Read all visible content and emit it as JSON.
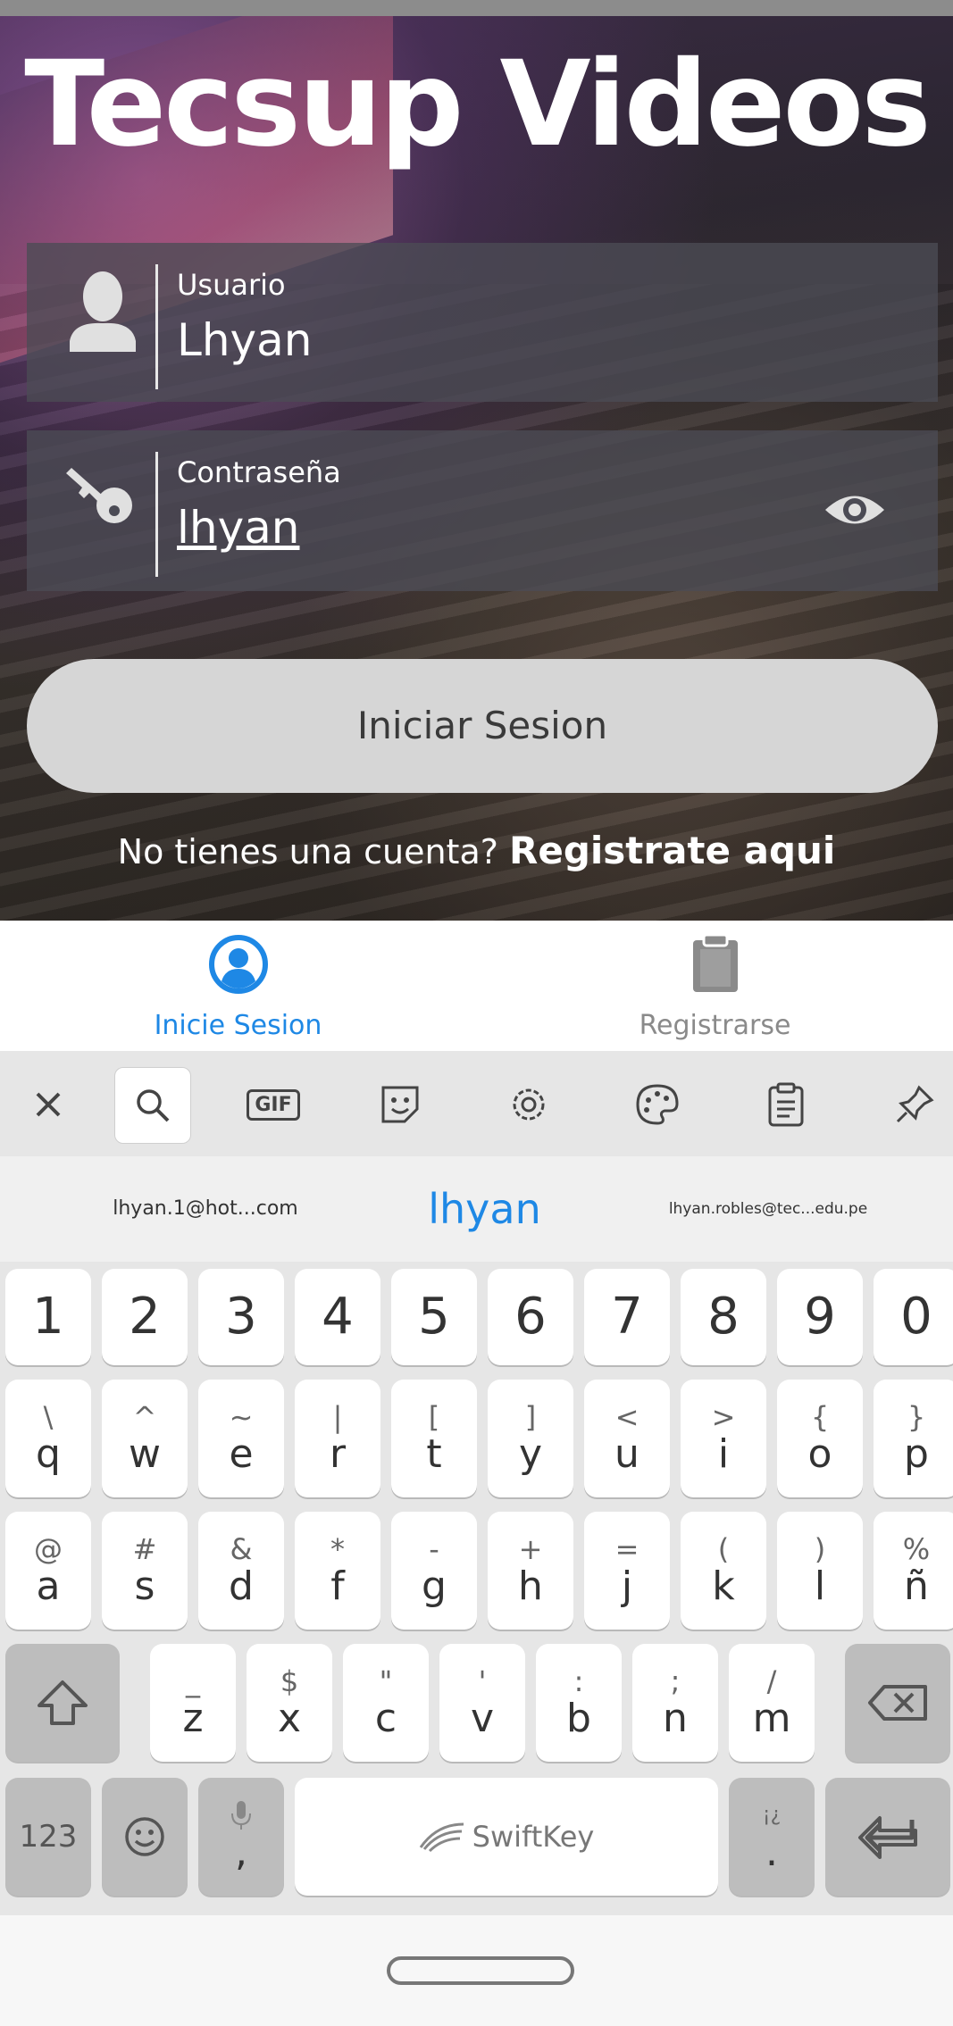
{
  "app": {
    "title": "Tecsup Videos"
  },
  "login": {
    "user_label": "Usuario",
    "user_value": "Lhyan",
    "pass_label": "Contraseña",
    "pass_value": "lhyan",
    "button": "Iniciar Sesion",
    "no_account": "No tienes una cuenta?",
    "register_link": "Registrate aqui"
  },
  "nav": {
    "login_tab": "Inicie Sesion",
    "register_tab": "Registrarse"
  },
  "keyboard": {
    "suggestions": [
      "lhyan.1@hot...com",
      "lhyan",
      "lhyan.robles@tec...edu.pe"
    ],
    "number_row": [
      "1",
      "2",
      "3",
      "4",
      "5",
      "6",
      "7",
      "8",
      "9",
      "0"
    ],
    "row1": [
      [
        "\\",
        "q"
      ],
      [
        "^",
        "w"
      ],
      [
        "~",
        "e"
      ],
      [
        "|",
        "r"
      ],
      [
        "[",
        "t"
      ],
      [
        "]",
        "y"
      ],
      [
        "<",
        "u"
      ],
      [
        ">",
        "i"
      ],
      [
        "{",
        "o"
      ],
      [
        "}",
        "p"
      ]
    ],
    "row2": [
      [
        "@",
        "a"
      ],
      [
        "#",
        "s"
      ],
      [
        "&",
        "d"
      ],
      [
        "*",
        "f"
      ],
      [
        "-",
        "g"
      ],
      [
        "+",
        "h"
      ],
      [
        "=",
        "j"
      ],
      [
        "(",
        "k"
      ],
      [
        ")",
        "l"
      ],
      [
        "%",
        "ñ"
      ]
    ],
    "row3": [
      [
        "_",
        "z"
      ],
      [
        "$",
        "x"
      ],
      [
        "\"",
        "c"
      ],
      [
        "'",
        "v"
      ],
      [
        ":",
        "b"
      ],
      [
        ";",
        "n"
      ],
      [
        "/",
        "m"
      ]
    ],
    "symbols_key": "123",
    "comma_key": ",",
    "period_key": ".",
    "period_hint": "¡¿",
    "space_brand": "SwiftKey",
    "gif_label": "GIF"
  },
  "colors": {
    "accent": "#1e88e5",
    "inactive": "#8a8a8a"
  }
}
